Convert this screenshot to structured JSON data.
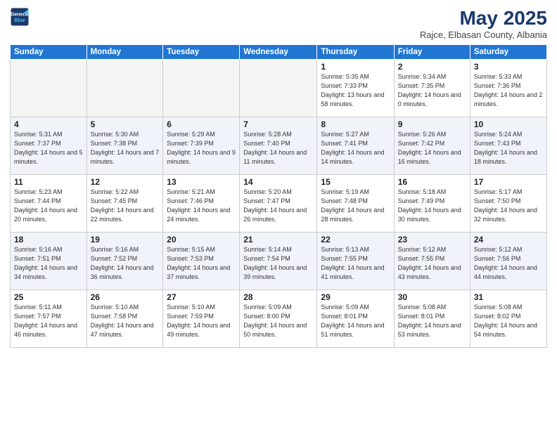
{
  "header": {
    "logo_line1": "General",
    "logo_line2": "Blue",
    "month_year": "May 2025",
    "location": "Rajce, Elbasan County, Albania"
  },
  "weekdays": [
    "Sunday",
    "Monday",
    "Tuesday",
    "Wednesday",
    "Thursday",
    "Friday",
    "Saturday"
  ],
  "weeks": [
    [
      {
        "day": null
      },
      {
        "day": null
      },
      {
        "day": null
      },
      {
        "day": null
      },
      {
        "day": 1,
        "sunrise": "5:35 AM",
        "sunset": "7:33 PM",
        "daylight": "13 hours and 58 minutes."
      },
      {
        "day": 2,
        "sunrise": "5:34 AM",
        "sunset": "7:35 PM",
        "daylight": "14 hours and 0 minutes."
      },
      {
        "day": 3,
        "sunrise": "5:33 AM",
        "sunset": "7:36 PM",
        "daylight": "14 hours and 2 minutes."
      }
    ],
    [
      {
        "day": 4,
        "sunrise": "5:31 AM",
        "sunset": "7:37 PM",
        "daylight": "14 hours and 5 minutes."
      },
      {
        "day": 5,
        "sunrise": "5:30 AM",
        "sunset": "7:38 PM",
        "daylight": "14 hours and 7 minutes."
      },
      {
        "day": 6,
        "sunrise": "5:29 AM",
        "sunset": "7:39 PM",
        "daylight": "14 hours and 9 minutes."
      },
      {
        "day": 7,
        "sunrise": "5:28 AM",
        "sunset": "7:40 PM",
        "daylight": "14 hours and 11 minutes."
      },
      {
        "day": 8,
        "sunrise": "5:27 AM",
        "sunset": "7:41 PM",
        "daylight": "14 hours and 14 minutes."
      },
      {
        "day": 9,
        "sunrise": "5:26 AM",
        "sunset": "7:42 PM",
        "daylight": "14 hours and 16 minutes."
      },
      {
        "day": 10,
        "sunrise": "5:24 AM",
        "sunset": "7:43 PM",
        "daylight": "14 hours and 18 minutes."
      }
    ],
    [
      {
        "day": 11,
        "sunrise": "5:23 AM",
        "sunset": "7:44 PM",
        "daylight": "14 hours and 20 minutes."
      },
      {
        "day": 12,
        "sunrise": "5:22 AM",
        "sunset": "7:45 PM",
        "daylight": "14 hours and 22 minutes."
      },
      {
        "day": 13,
        "sunrise": "5:21 AM",
        "sunset": "7:46 PM",
        "daylight": "14 hours and 24 minutes."
      },
      {
        "day": 14,
        "sunrise": "5:20 AM",
        "sunset": "7:47 PM",
        "daylight": "14 hours and 26 minutes."
      },
      {
        "day": 15,
        "sunrise": "5:19 AM",
        "sunset": "7:48 PM",
        "daylight": "14 hours and 28 minutes."
      },
      {
        "day": 16,
        "sunrise": "5:18 AM",
        "sunset": "7:49 PM",
        "daylight": "14 hours and 30 minutes."
      },
      {
        "day": 17,
        "sunrise": "5:17 AM",
        "sunset": "7:50 PM",
        "daylight": "14 hours and 32 minutes."
      }
    ],
    [
      {
        "day": 18,
        "sunrise": "5:16 AM",
        "sunset": "7:51 PM",
        "daylight": "14 hours and 34 minutes."
      },
      {
        "day": 19,
        "sunrise": "5:16 AM",
        "sunset": "7:52 PM",
        "daylight": "14 hours and 36 minutes."
      },
      {
        "day": 20,
        "sunrise": "5:15 AM",
        "sunset": "7:53 PM",
        "daylight": "14 hours and 37 minutes."
      },
      {
        "day": 21,
        "sunrise": "5:14 AM",
        "sunset": "7:54 PM",
        "daylight": "14 hours and 39 minutes."
      },
      {
        "day": 22,
        "sunrise": "5:13 AM",
        "sunset": "7:55 PM",
        "daylight": "14 hours and 41 minutes."
      },
      {
        "day": 23,
        "sunrise": "5:12 AM",
        "sunset": "7:55 PM",
        "daylight": "14 hours and 43 minutes."
      },
      {
        "day": 24,
        "sunrise": "5:12 AM",
        "sunset": "7:56 PM",
        "daylight": "14 hours and 44 minutes."
      }
    ],
    [
      {
        "day": 25,
        "sunrise": "5:11 AM",
        "sunset": "7:57 PM",
        "daylight": "14 hours and 46 minutes."
      },
      {
        "day": 26,
        "sunrise": "5:10 AM",
        "sunset": "7:58 PM",
        "daylight": "14 hours and 47 minutes."
      },
      {
        "day": 27,
        "sunrise": "5:10 AM",
        "sunset": "7:59 PM",
        "daylight": "14 hours and 49 minutes."
      },
      {
        "day": 28,
        "sunrise": "5:09 AM",
        "sunset": "8:00 PM",
        "daylight": "14 hours and 50 minutes."
      },
      {
        "day": 29,
        "sunrise": "5:09 AM",
        "sunset": "8:01 PM",
        "daylight": "14 hours and 51 minutes."
      },
      {
        "day": 30,
        "sunrise": "5:08 AM",
        "sunset": "8:01 PM",
        "daylight": "14 hours and 53 minutes."
      },
      {
        "day": 31,
        "sunrise": "5:08 AM",
        "sunset": "8:02 PM",
        "daylight": "14 hours and 54 minutes."
      }
    ]
  ]
}
